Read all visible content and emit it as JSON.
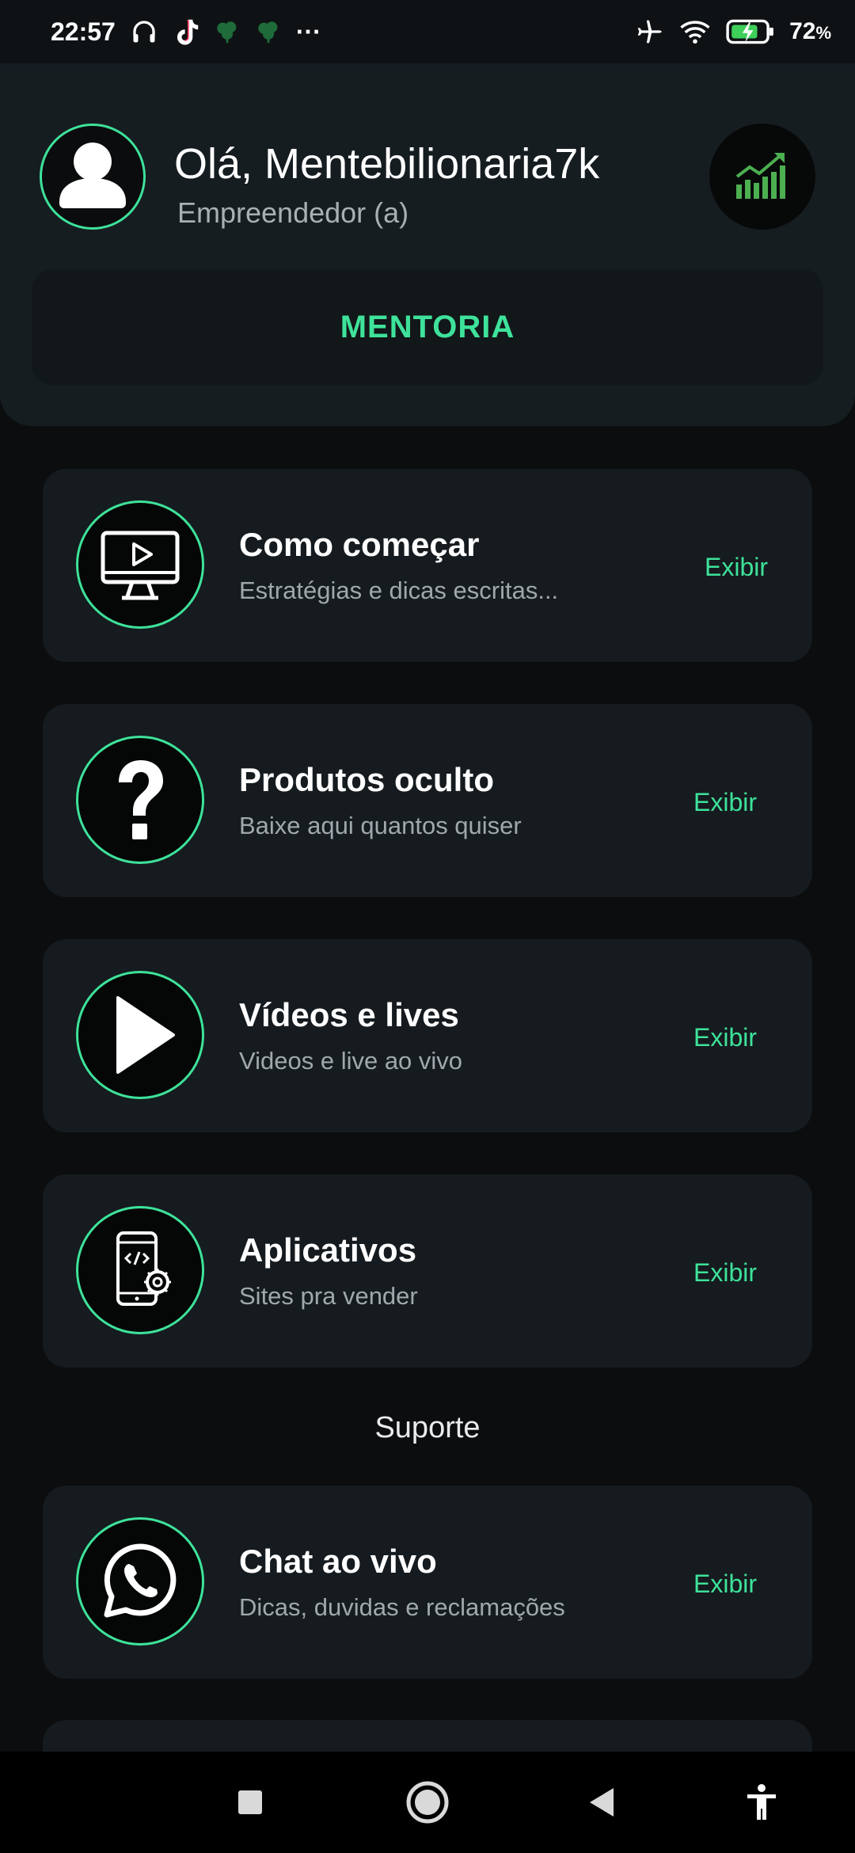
{
  "status_bar": {
    "time": "22:57",
    "more": "···",
    "battery_pct": "72",
    "battery_unit": "%",
    "icons_left": [
      "headphones-icon",
      "tiktok-icon",
      "leaf-icon",
      "leaf-icon",
      "more-icon"
    ],
    "icons_right": [
      "airplane-icon",
      "wifi-icon",
      "battery-charging-icon"
    ]
  },
  "header": {
    "greeting": "Olá, Mentebilionaria7k",
    "role": "Empreendedor (a)",
    "mentoria_label": "MENTORIA",
    "chart_icon": "growth-chart-icon",
    "avatar_icon": "user-icon"
  },
  "cards": [
    {
      "title": "Como começar",
      "subtitle": "Estratégias e dicas escritas...",
      "action": "Exibir",
      "icon": "monitor-play-icon"
    },
    {
      "title": "Produtos oculto",
      "subtitle": "Baixe aqui quantos quiser",
      "action": "Exibir",
      "icon": "question-mark-icon"
    },
    {
      "title": "Vídeos e lives",
      "subtitle": "Videos e live ao vivo",
      "action": "Exibir",
      "icon": "play-icon"
    },
    {
      "title": "Aplicativos",
      "subtitle": "Sites pra vender",
      "action": "Exibir",
      "icon": "mobile-code-icon"
    }
  ],
  "support": {
    "label": "Suporte",
    "card": {
      "title": "Chat ao vivo",
      "subtitle": "Dicas, duvidas e reclamações",
      "action": "Exibir",
      "icon": "whatsapp-icon"
    }
  },
  "nav": [
    "recents-icon",
    "home-icon",
    "back-icon",
    "accessibility-icon"
  ],
  "colors": {
    "accent": "#3ee29a",
    "background": "#0b0d0e",
    "card": "#151b1f"
  }
}
